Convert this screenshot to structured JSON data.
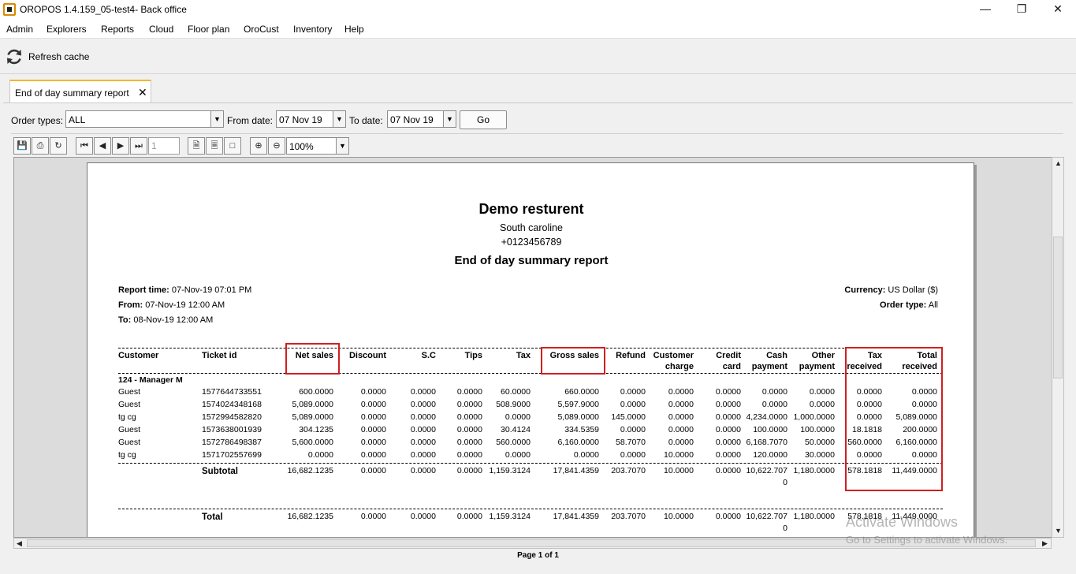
{
  "window": {
    "title": "OROPOS 1.4.159_05-test4- Back office"
  },
  "menu": [
    "Admin",
    "Explorers",
    "Reports",
    "Cloud",
    "Floor plan",
    "OroCust",
    "Inventory",
    "Help"
  ],
  "toolbar": {
    "refresh_label": "Refresh cache"
  },
  "tab": {
    "label": "End of day summary report"
  },
  "filters": {
    "order_types_label": "Order types:",
    "order_types_value": "ALL",
    "from_label": "From date:",
    "from_value": "07 Nov 19",
    "to_label": "To date:",
    "to_value": "07 Nov 19",
    "go_label": "Go"
  },
  "viewer": {
    "page_input_placeholder": "1",
    "zoom": "100%",
    "page_status": "Page 1 of 1"
  },
  "report": {
    "restaurant": "Demo resturent",
    "address": "South caroline",
    "phone": "+0123456789",
    "title": "End of day summary report",
    "report_time_label": "Report time:",
    "report_time": " 07-Nov-19 07:01 PM",
    "from_label": "From:",
    "from": " 07-Nov-19 12:00 AM",
    "to_label": "To:",
    "to": " 08-Nov-19 12:00 AM",
    "currency_label": "Currency:",
    "currency": " US Dollar ($)",
    "order_type_label": "Order type:",
    "order_type": " All",
    "columns": {
      "customer": "Customer",
      "ticket": "Ticket id",
      "net": "Net sales",
      "discount": "Discount",
      "sc": "S.C",
      "tips": "Tips",
      "tax": "Tax",
      "gross": "Gross sales",
      "refund": "Refund",
      "cust_charge_1": "Customer",
      "cust_charge_2": "charge",
      "credit_1": "Credit",
      "credit_2": "card",
      "cash_1": "Cash",
      "cash_2": "payment",
      "other_1": "Other",
      "other_2": "payment",
      "taxrec_1": "Tax",
      "taxrec_2": "received",
      "totalrec_1": "Total",
      "totalrec_2": "received"
    },
    "group": "124 - Manager M",
    "rows": [
      {
        "customer": "Guest",
        "ticket": "1577644733551",
        "net": "600.0000",
        "discount": "0.0000",
        "sc": "0.0000",
        "tips": "0.0000",
        "tax": "60.0000",
        "gross": "660.0000",
        "refund": "0.0000",
        "cust_charge": "0.0000",
        "credit": "0.0000",
        "cash": "0.0000",
        "other": "0.0000",
        "taxrec": "0.0000",
        "totalrec": "0.0000"
      },
      {
        "customer": "Guest",
        "ticket": "1574024348168",
        "net": "5,089.0000",
        "discount": "0.0000",
        "sc": "0.0000",
        "tips": "0.0000",
        "tax": "508.9000",
        "gross": "5,597.9000",
        "refund": "0.0000",
        "cust_charge": "0.0000",
        "credit": "0.0000",
        "cash": "0.0000",
        "other": "0.0000",
        "taxrec": "0.0000",
        "totalrec": "0.0000"
      },
      {
        "customer": "tg cg",
        "ticket": "1572994582820",
        "net": "5,089.0000",
        "discount": "0.0000",
        "sc": "0.0000",
        "tips": "0.0000",
        "tax": "0.0000",
        "gross": "5,089.0000",
        "refund": "145.0000",
        "cust_charge": "0.0000",
        "credit": "0.0000",
        "cash": "4,234.0000",
        "other": "1,000.0000",
        "taxrec": "0.0000",
        "totalrec": "5,089.0000"
      },
      {
        "customer": "Guest",
        "ticket": "1573638001939",
        "net": "304.1235",
        "discount": "0.0000",
        "sc": "0.0000",
        "tips": "0.0000",
        "tax": "30.4124",
        "gross": "334.5359",
        "refund": "0.0000",
        "cust_charge": "0.0000",
        "credit": "0.0000",
        "cash": "100.0000",
        "other": "100.0000",
        "taxrec": "18.1818",
        "totalrec": "200.0000"
      },
      {
        "customer": "Guest",
        "ticket": "1572786498387",
        "net": "5,600.0000",
        "discount": "0.0000",
        "sc": "0.0000",
        "tips": "0.0000",
        "tax": "560.0000",
        "gross": "6,160.0000",
        "refund": "58.7070",
        "cust_charge": "0.0000",
        "credit": "0.0000",
        "cash": "6,168.7070",
        "other": "50.0000",
        "taxrec": "560.0000",
        "totalrec": "6,160.0000"
      },
      {
        "customer": "tg cg",
        "ticket": "1571702557699",
        "net": "0.0000",
        "discount": "0.0000",
        "sc": "0.0000",
        "tips": "0.0000",
        "tax": "0.0000",
        "gross": "0.0000",
        "refund": "0.0000",
        "cust_charge": "10.0000",
        "credit": "0.0000",
        "cash": "120.0000",
        "other": "30.0000",
        "taxrec": "0.0000",
        "totalrec": "0.0000"
      }
    ],
    "subtotal": {
      "label": "Subtotal",
      "net": "16,682.1235",
      "discount": "0.0000",
      "sc": "0.0000",
      "tips": "0.0000",
      "tax": "1,159.3124",
      "gross": "17,841.4359",
      "refund": "203.7070",
      "cust_charge": "10.0000",
      "credit": "0.0000",
      "cash_1": "10,622.707",
      "cash_2": "0",
      "other": "1,180.0000",
      "taxrec": "578.1818",
      "totalrec": "11,449.0000"
    },
    "total": {
      "label": "Total",
      "net": "16,682.1235",
      "discount": "0.0000",
      "sc": "0.0000",
      "tips": "0.0000",
      "tax": "1,159.3124",
      "gross": "17,841.4359",
      "refund": "203.7070",
      "cust_charge": "10.0000",
      "credit": "0.0000",
      "cash_1": "10,622.707",
      "cash_2": "0",
      "other": "1,180.0000",
      "taxrec": "578.1818",
      "totalrec": "11,449.0000"
    }
  },
  "watermark": {
    "line1": "Activate Windows",
    "line2": "Go to Settings to activate Windows."
  },
  "colors": {
    "tab_accent": "#f2b632",
    "highlight_box": "#d11f1f"
  }
}
